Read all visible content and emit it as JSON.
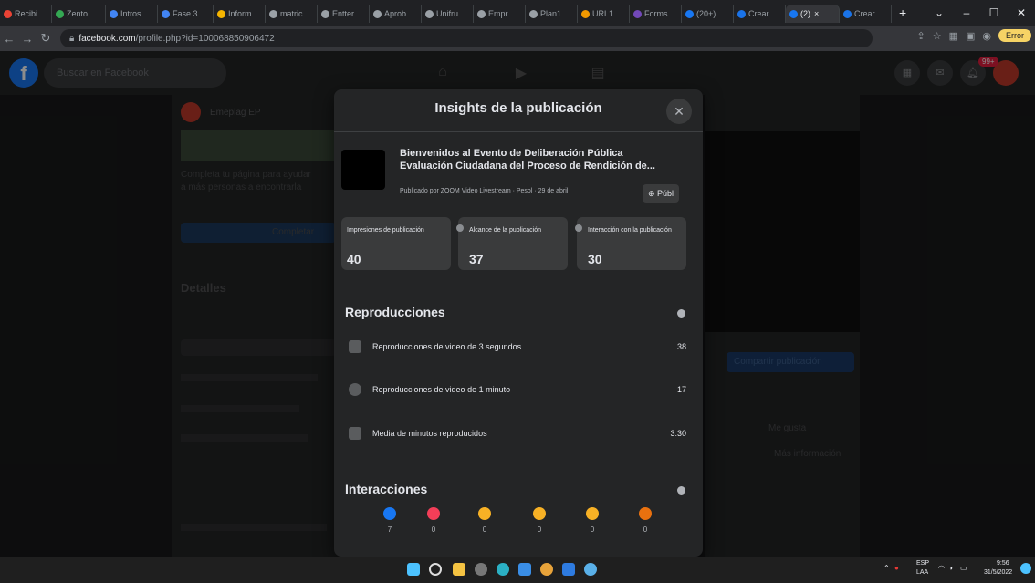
{
  "browser": {
    "tabs": [
      {
        "label": "Recibi"
      },
      {
        "label": "Zento"
      },
      {
        "label": "Intros"
      },
      {
        "label": "Fase 3"
      },
      {
        "label": "Inform"
      },
      {
        "label": "matric"
      },
      {
        "label": "Entter"
      },
      {
        "label": "Aprob"
      },
      {
        "label": "Unifru"
      },
      {
        "label": "Empr"
      },
      {
        "label": "Plan1"
      },
      {
        "label": "URL1"
      },
      {
        "label": "Forms"
      },
      {
        "label": "(20+)"
      },
      {
        "label": "Crear"
      },
      {
        "label": "(2)"
      },
      {
        "label": "Crear"
      }
    ],
    "url_domain": "facebook.com",
    "url_path": "/profile.php?id=100068850906472",
    "error_button": "Error"
  },
  "facebook": {
    "search_placeholder": "Buscar en Facebook",
    "badge_count": "99+"
  },
  "background": {
    "page_name": "Emeplag EP",
    "details_heading": "Detalles",
    "left_lines": [
      "Completa tu página para ayudar",
      "a más personas a encontrarla",
      "Completar"
    ],
    "right_button": "Compartir publicación",
    "right_lines": [
      "Me gusta",
      "Más información"
    ]
  },
  "modal": {
    "title": "Insights de la publicación",
    "post_title_1": "Bienvenidos al Evento de Deliberación Pública",
    "post_title_2": "Evaluación Ciudadana del Proceso de Rendición de...",
    "post_meta": "Publicado por ZOOM Video Livestream · Pesol ·",
    "post_date": "29 de abril",
    "public_button": "Públ",
    "stats": [
      {
        "label": "Impresiones de publicación",
        "value": "40"
      },
      {
        "label": "Alcance de la publicación",
        "value": "37"
      },
      {
        "label": "Interacción con la publicación",
        "value": "30"
      }
    ],
    "reproducciones_heading": "Reproducciones",
    "rows": [
      {
        "label": "Reproducciones de video de 3 segundos",
        "value": "38"
      },
      {
        "label": "Reproducciones de video de 1 minuto",
        "value": "17"
      },
      {
        "label": "Media de minutos reproducidos",
        "value": "3:30"
      }
    ],
    "interacciones_heading": "Interacciones",
    "reactions": [
      {
        "icon": "like-icon",
        "color": "#1877f2",
        "count": "7"
      },
      {
        "icon": "love-icon",
        "color": "#f33e58",
        "count": "0"
      },
      {
        "icon": "haha-icon",
        "color": "#f7b125",
        "count": "0"
      },
      {
        "icon": "wow-icon",
        "color": "#f7b125",
        "count": "0"
      },
      {
        "icon": "sad-icon",
        "color": "#f7b125",
        "count": "0"
      },
      {
        "icon": "angry-icon",
        "color": "#e9710f",
        "count": "0"
      }
    ]
  },
  "taskbar": {
    "lang_1": "ESP",
    "lang_2": "LAA",
    "time": "9:56",
    "date": "31/5/2022"
  }
}
